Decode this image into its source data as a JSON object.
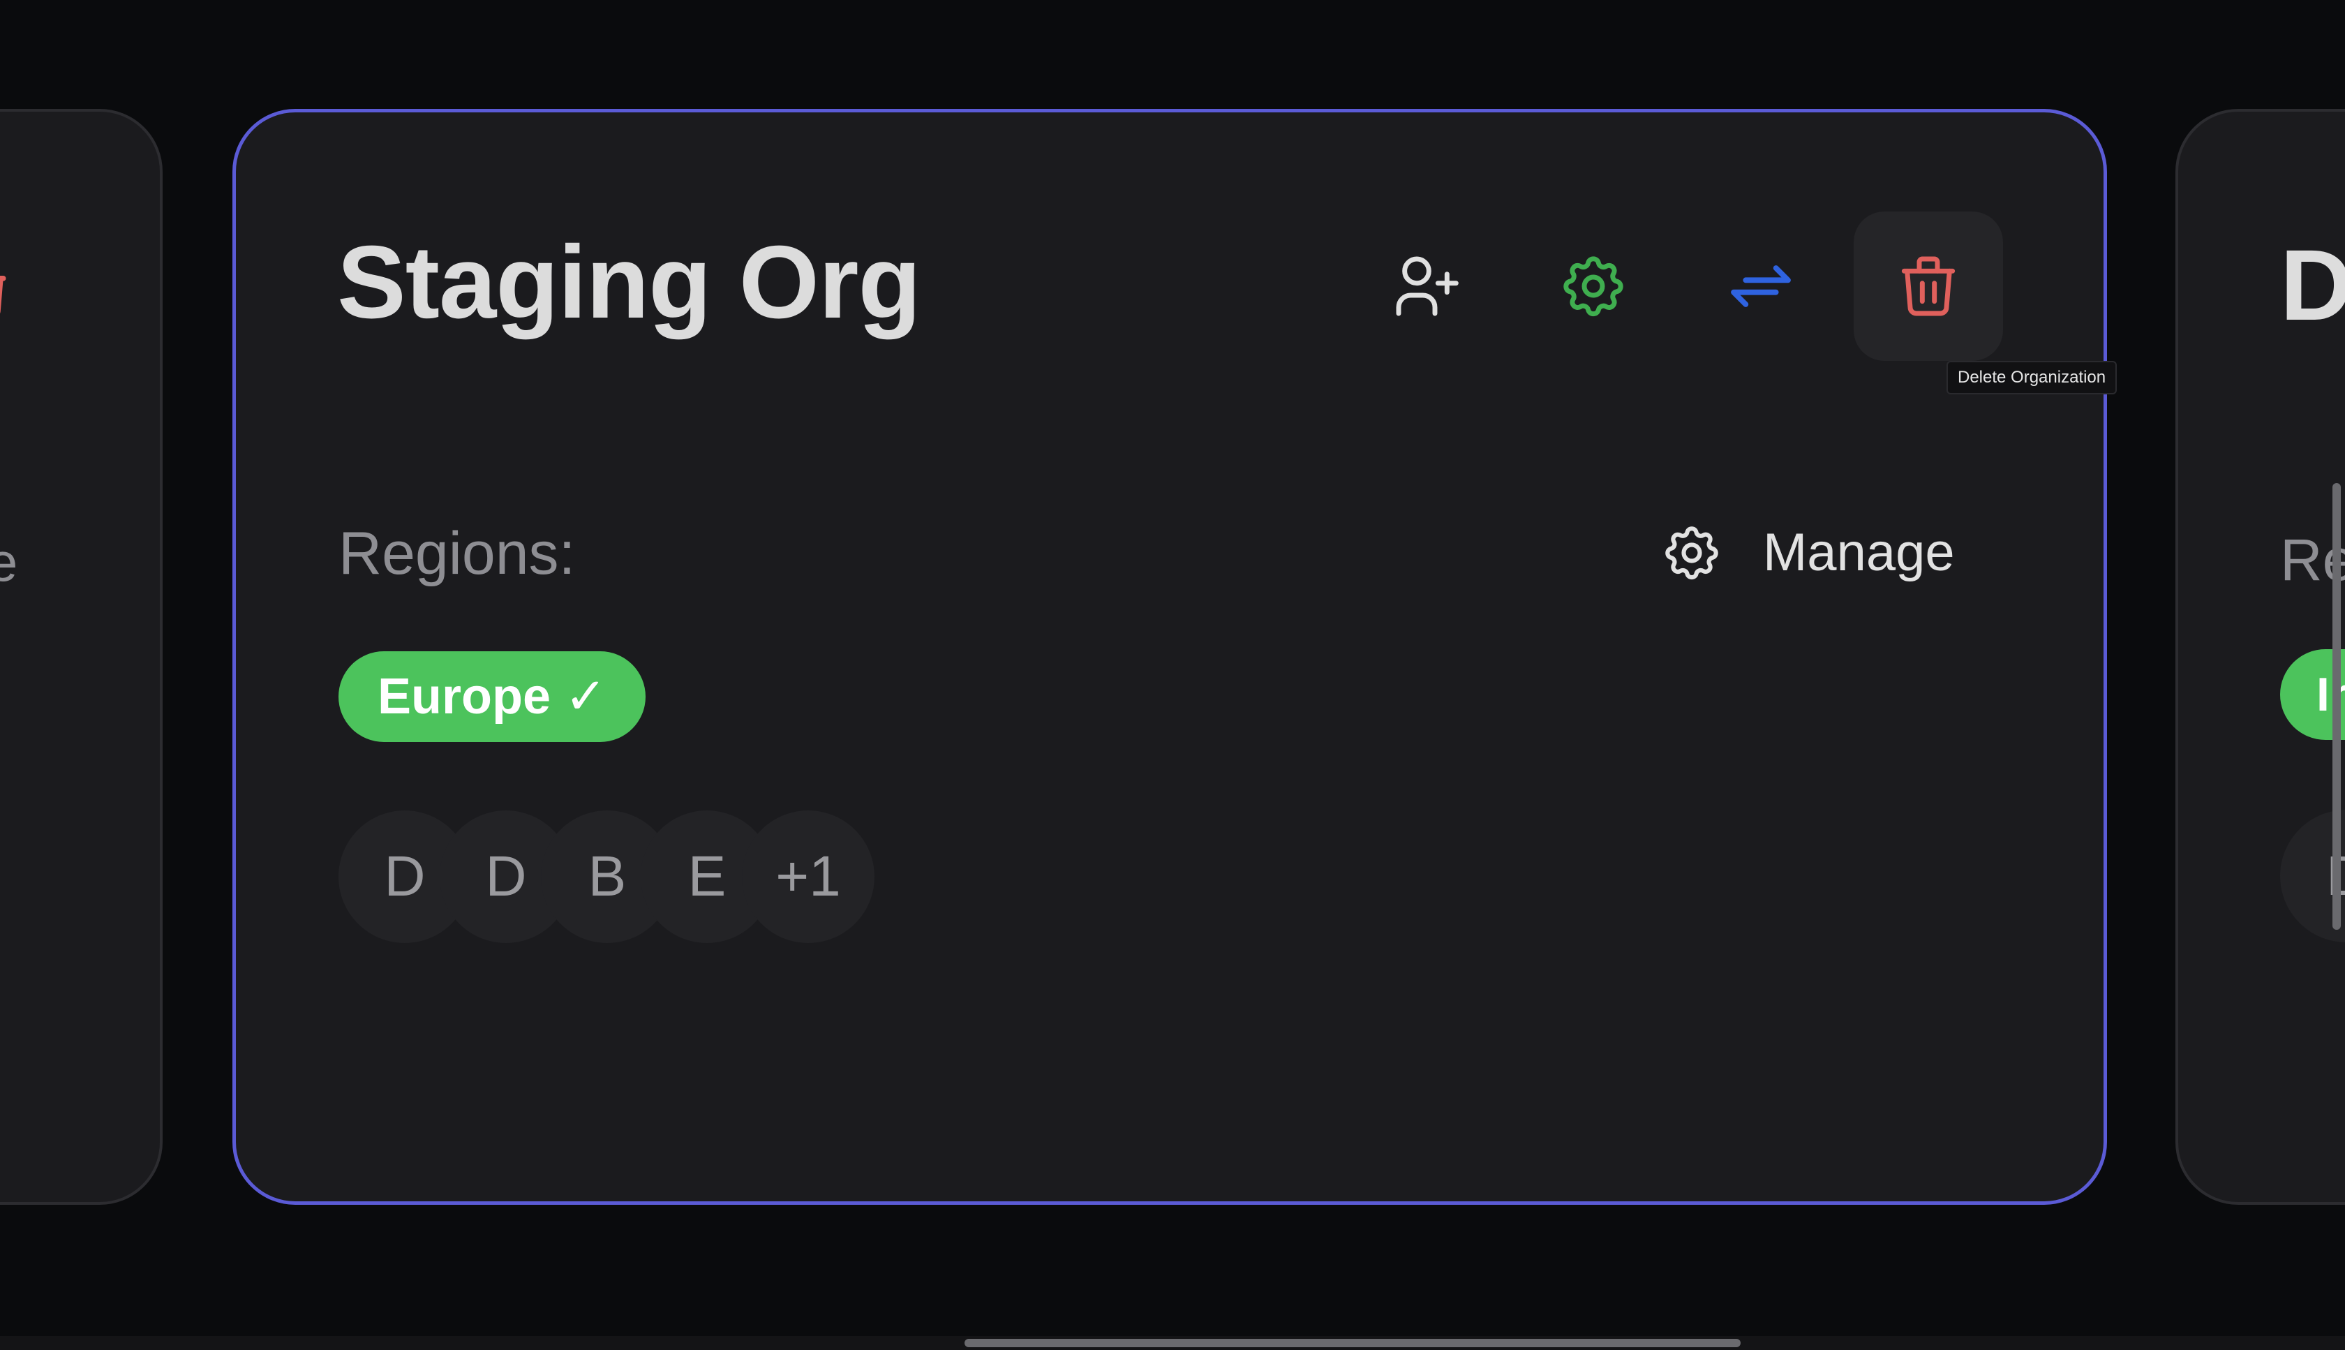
{
  "colors": {
    "page_background": "#0a0b0d",
    "card_background": "#1b1b1e",
    "selected_card_border": "#5b5bd6",
    "region_pill": "#4cc35c",
    "add_user_icon": "#e0e0e0",
    "settings_icon": "#3fae4f",
    "transfer_icon": "#2f63e0",
    "delete_icon": "#e0605c"
  },
  "cards": {
    "left": {
      "title_fragment": "",
      "region_fragment": "e"
    },
    "main": {
      "title": "Staging Org",
      "actions": {
        "add_user_icon": "user-plus-icon",
        "settings_icon": "gear-icon",
        "transfer_icon": "arrows-exchange-icon",
        "delete_icon": "trash-icon",
        "delete_tooltip": "Delete Organization"
      },
      "regions_label": "Regions:",
      "manage_label": "Manage",
      "regions": [
        {
          "label": "Europe ✓"
        }
      ],
      "members": [
        {
          "initial": "D"
        },
        {
          "initial": "D"
        },
        {
          "initial": "B"
        },
        {
          "initial": "E"
        },
        {
          "initial": "+1"
        }
      ]
    },
    "right": {
      "title_fragment": "D",
      "regions_fragment": "Re",
      "region_fragment": "Ir",
      "member_fragment": "D"
    }
  }
}
